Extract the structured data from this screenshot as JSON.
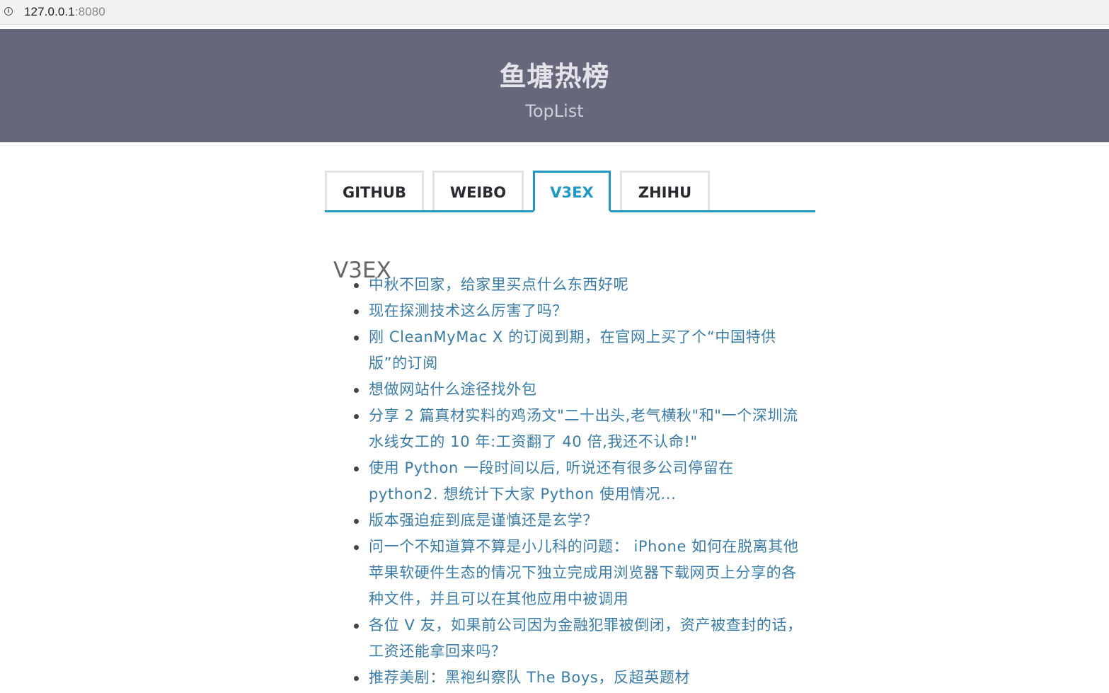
{
  "browser": {
    "url_host": "127.0.0.1",
    "url_port": ":8080"
  },
  "hero": {
    "title": "鱼塘热榜",
    "subtitle": "TopList"
  },
  "tabs": [
    {
      "label": "GITHUB"
    },
    {
      "label": "WEIBO"
    },
    {
      "label": "V3EX"
    },
    {
      "label": "ZHIHU"
    }
  ],
  "active_tab": "V3EX",
  "section": {
    "title": "V3EX",
    "items": [
      "中秋不回家，给家里买点什么东西好呢",
      "现在探测技术这么厉害了吗？",
      "刚 CleanMyMac X 的订阅到期，在官网上买了个“中国特供版”的订阅",
      "想做网站什么途径找外包",
      "分享 2 篇真材实料的鸡汤文\"二十出头,老气横秋\"和\"一个深圳流水线女工的 10 年:工资翻了 40 倍,我还不认命!\"",
      "使用 Python 一段时间以后, 听说还有很多公司停留在 python2. 想统计下大家 Python 使用情况...",
      "版本强迫症到底是谨慎还是玄学？",
      "问一个不知道算不算是小儿科的问题： iPhone 如何在脱离其他苹果软硬件生态的情况下独立完成用浏览器下载网页上分享的各种文件，并且可以在其他应用中被调用",
      "各位 V 友，如果前公司因为金融犯罪被倒闭，资产被查封的话，工资还能拿回来吗？",
      "推荐美剧：黑袍纠察队 The Boys，反超英题材"
    ]
  }
}
